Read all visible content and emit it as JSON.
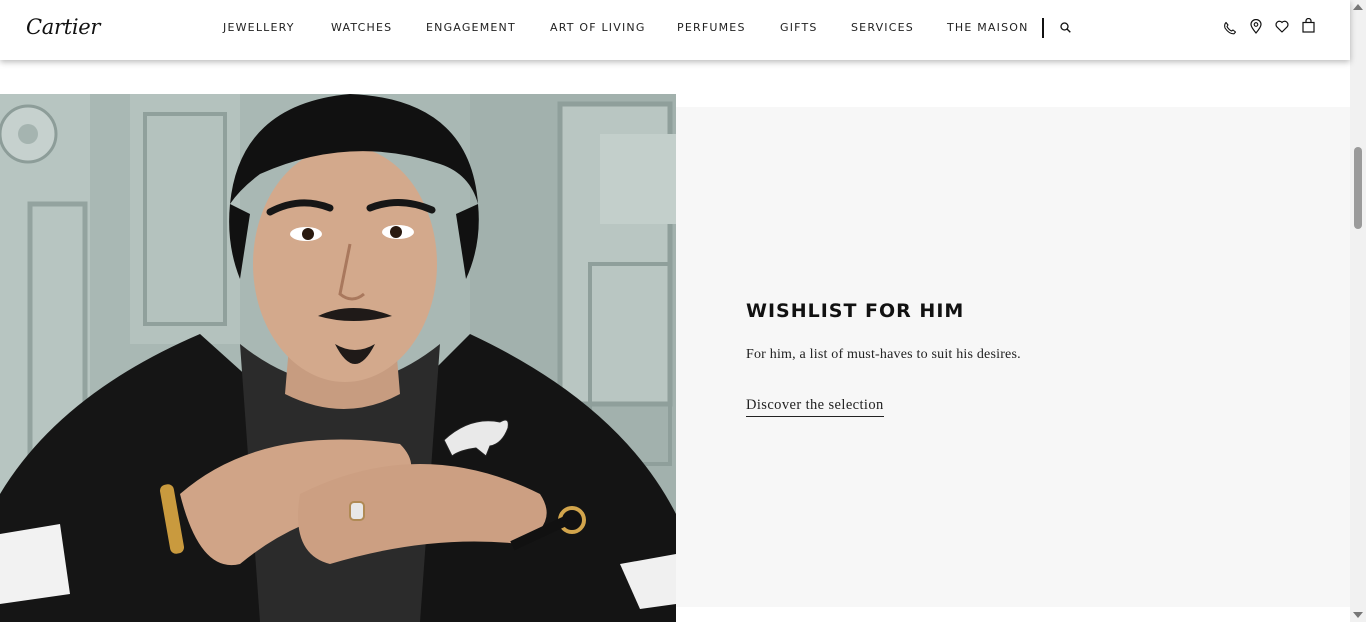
{
  "brand": {
    "logo_text": "Cartier"
  },
  "nav": {
    "items": [
      {
        "label": "JEWELLERY"
      },
      {
        "label": "WATCHES"
      },
      {
        "label": "ENGAGEMENT"
      },
      {
        "label": "ART OF LIVING"
      },
      {
        "label": "PERFUMES"
      },
      {
        "label": "GIFTS"
      },
      {
        "label": "SERVICES"
      },
      {
        "label": "THE MAISON"
      }
    ]
  },
  "header_icons": [
    "search-icon",
    "phone-icon",
    "location-pin-icon",
    "heart-icon",
    "shopping-bag-icon"
  ],
  "hero_image": {
    "alt": "Man in black jacket wearing a panther brooch, gold bracelet and watch"
  },
  "feature": {
    "title": "WISHLIST FOR HIM",
    "description": "For him, a list of must-haves to suit his desires.",
    "link_label": "Discover the selection"
  },
  "colors": {
    "panel_background": "#f7f7f7",
    "text": "#111111",
    "wall": "#a9b8b4"
  }
}
